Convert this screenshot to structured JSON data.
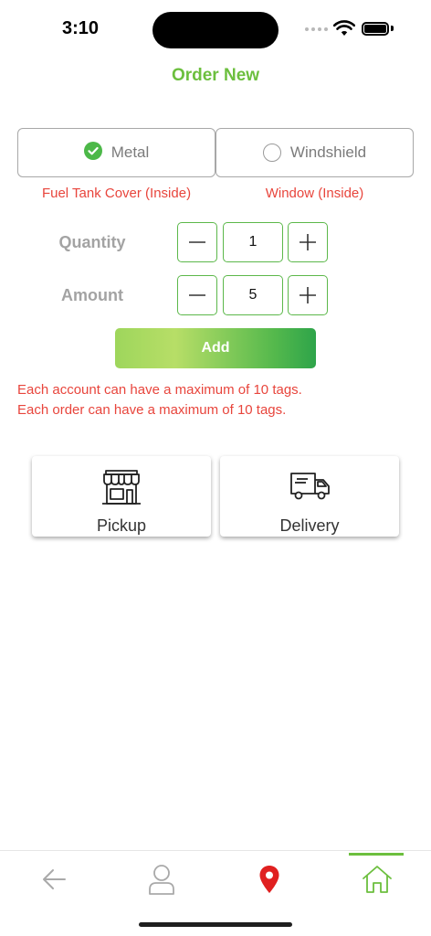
{
  "status_bar": {
    "time": "3:10"
  },
  "header": {
    "title": "Order New"
  },
  "options": [
    {
      "label": "Metal",
      "sub_label": "Fuel Tank Cover (Inside)",
      "selected": true
    },
    {
      "label": "Windshield",
      "sub_label": "Window (Inside)",
      "selected": false
    }
  ],
  "quantity": {
    "label": "Quantity",
    "value": "1"
  },
  "amount": {
    "label": "Amount",
    "value": "5"
  },
  "add_button": {
    "label": "Add"
  },
  "notes": [
    "Each account can have a maximum of 10 tags.",
    "Each order can have a maximum of 10 tags."
  ],
  "methods": [
    {
      "label": "Pickup",
      "icon": "store-icon"
    },
    {
      "label": "Delivery",
      "icon": "delivery-truck-icon"
    }
  ],
  "bottom_nav": {
    "items": [
      {
        "icon": "back-arrow-icon"
      },
      {
        "icon": "user-icon"
      },
      {
        "icon": "location-pin-icon"
      },
      {
        "icon": "home-icon"
      }
    ],
    "active": "home"
  },
  "colors": {
    "accent": "#6cbf3e",
    "warning": "#e8453c",
    "pin": "#e02020"
  }
}
